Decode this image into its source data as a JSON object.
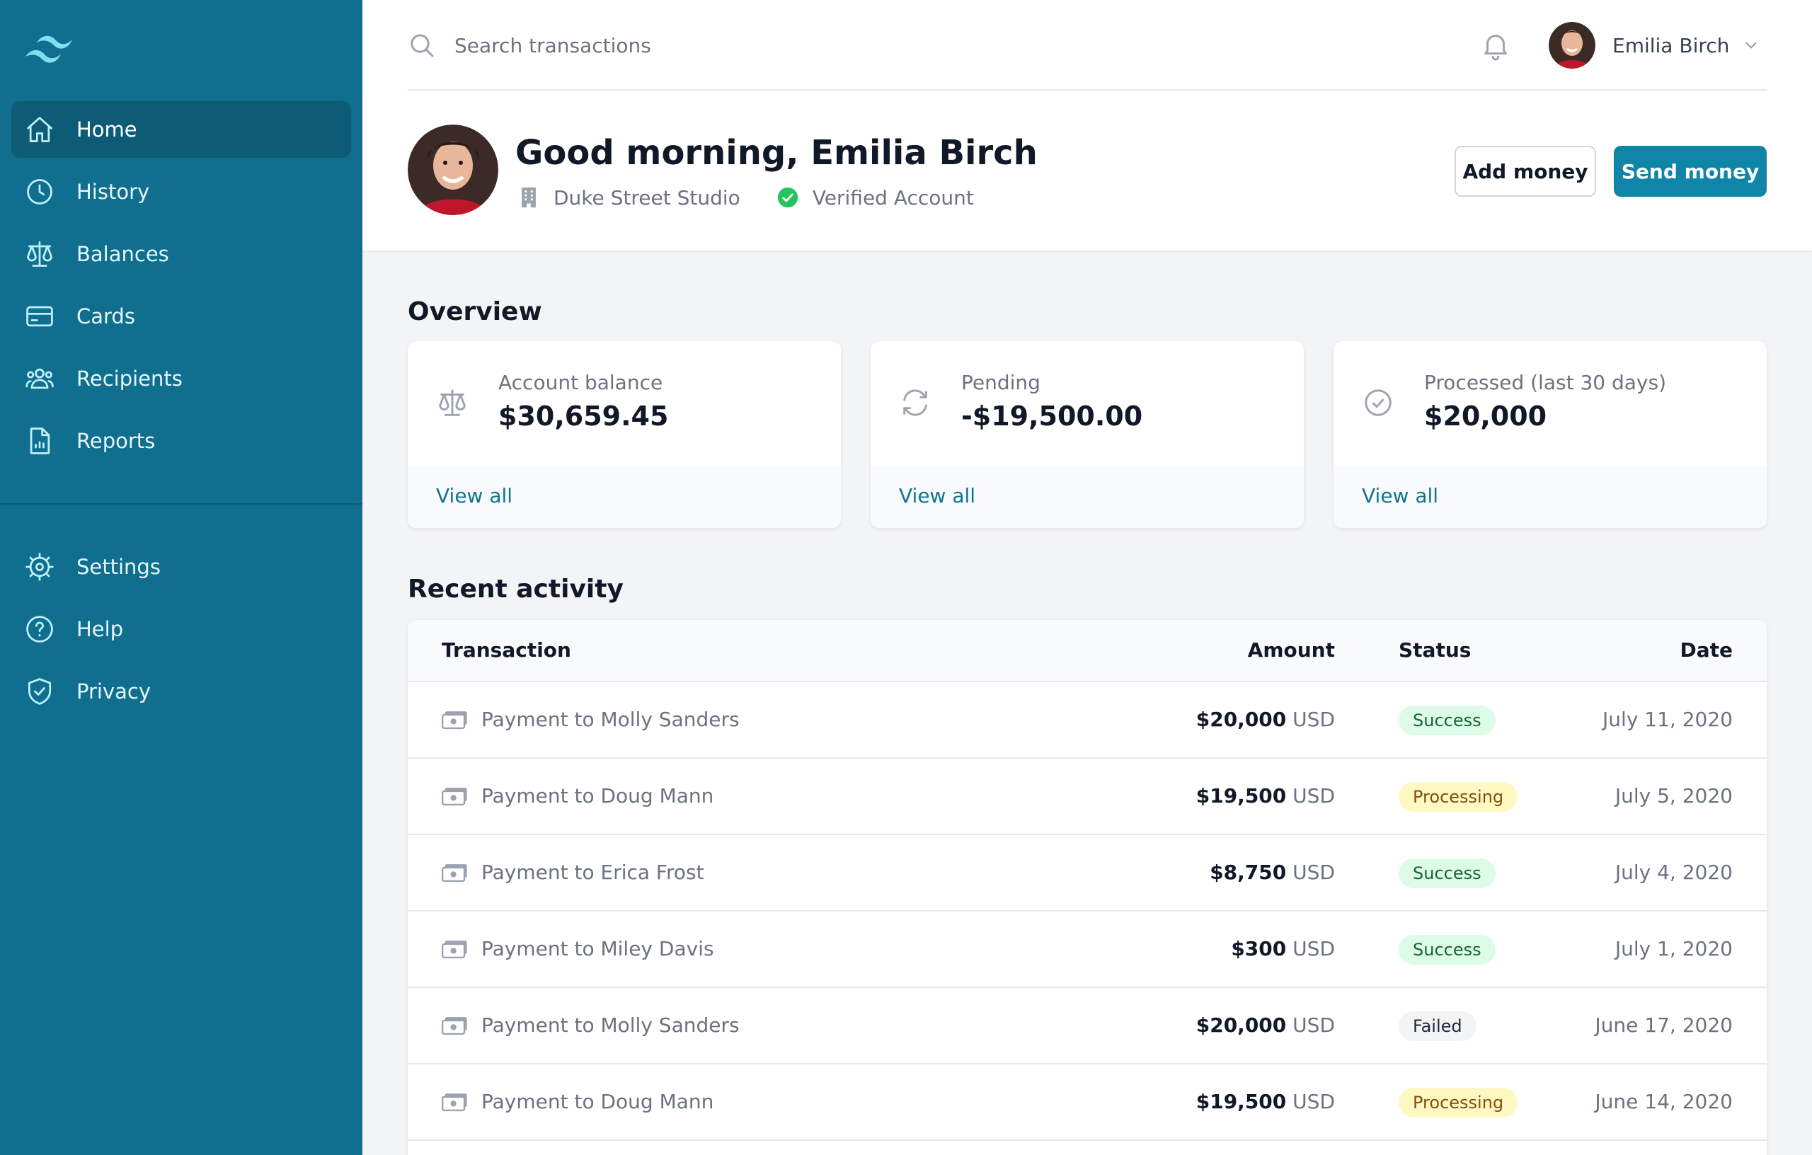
{
  "colors": {
    "sidebar": "#106f8e",
    "accent": "#0f86a8",
    "link": "#0e7490",
    "success": "#22c55e"
  },
  "sidebar": {
    "logo": "tailwind-logo-icon",
    "primary": [
      {
        "label": "Home",
        "icon": "home-icon",
        "active": true
      },
      {
        "label": "History",
        "icon": "clock-icon"
      },
      {
        "label": "Balances",
        "icon": "scale-icon"
      },
      {
        "label": "Cards",
        "icon": "credit-card-icon"
      },
      {
        "label": "Recipients",
        "icon": "user-group-icon"
      },
      {
        "label": "Reports",
        "icon": "document-report-icon"
      }
    ],
    "secondary": [
      {
        "label": "Settings",
        "icon": "cog-icon"
      },
      {
        "label": "Help",
        "icon": "question-circle-icon"
      },
      {
        "label": "Privacy",
        "icon": "shield-check-icon"
      }
    ]
  },
  "topbar": {
    "search_placeholder": "Search transactions",
    "user_name": "Emilia Birch"
  },
  "header": {
    "greeting": "Good morning, Emilia Birch",
    "company": "Duke Street Studio",
    "verified": "Verified Account",
    "add_money": "Add money",
    "send_money": "Send money"
  },
  "overview": {
    "title": "Overview",
    "cards": [
      {
        "label": "Account balance",
        "value": "$30,659.45",
        "link": "View all",
        "icon": "scale-icon"
      },
      {
        "label": "Pending",
        "value": "-$19,500.00",
        "link": "View all",
        "icon": "refresh-icon"
      },
      {
        "label": "Processed (last 30 days)",
        "value": "$20,000",
        "link": "View all",
        "icon": "check-circle-icon"
      }
    ]
  },
  "activity": {
    "title": "Recent activity",
    "columns": {
      "transaction": "Transaction",
      "amount": "Amount",
      "status": "Status",
      "date": "Date"
    },
    "rows": [
      {
        "name": "Payment to Molly Sanders",
        "amount": "$20,000",
        "currency": "USD",
        "status": "Success",
        "status_type": "success",
        "date": "July 11, 2020"
      },
      {
        "name": "Payment to Doug Mann",
        "amount": "$19,500",
        "currency": "USD",
        "status": "Processing",
        "status_type": "processing",
        "date": "July 5, 2020"
      },
      {
        "name": "Payment to Erica Frost",
        "amount": "$8,750",
        "currency": "USD",
        "status": "Success",
        "status_type": "success",
        "date": "July 4, 2020"
      },
      {
        "name": "Payment to Miley Davis",
        "amount": "$300",
        "currency": "USD",
        "status": "Success",
        "status_type": "success",
        "date": "July 1, 2020"
      },
      {
        "name": "Payment to Molly Sanders",
        "amount": "$20,000",
        "currency": "USD",
        "status": "Failed",
        "status_type": "failed",
        "date": "June 17, 2020"
      },
      {
        "name": "Payment to Doug Mann",
        "amount": "$19,500",
        "currency": "USD",
        "status": "Processing",
        "status_type": "processing",
        "date": "June 14, 2020"
      }
    ]
  }
}
